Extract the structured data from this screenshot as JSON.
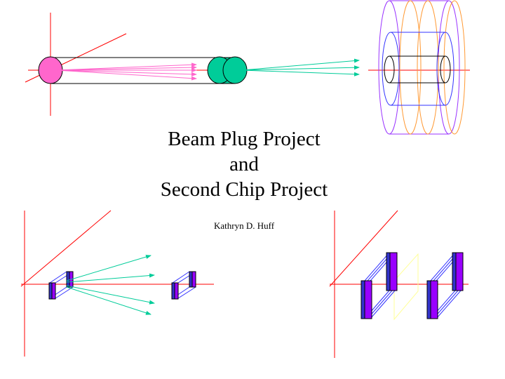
{
  "slide": {
    "title_lines": [
      "Beam Plug Project",
      "and",
      "Second Chip Project"
    ],
    "author": "Kathryn D. Huff"
  },
  "colors": {
    "axis": "#ff0000",
    "magenta": "#ff66cc",
    "teal": "#00cc99",
    "blue": "#3333ff",
    "purple": "#9933ff",
    "orange": "#ff9933",
    "yellow": "#ffff99",
    "chip_blue": "#3333cc",
    "chip_purple": "#9900ff"
  }
}
